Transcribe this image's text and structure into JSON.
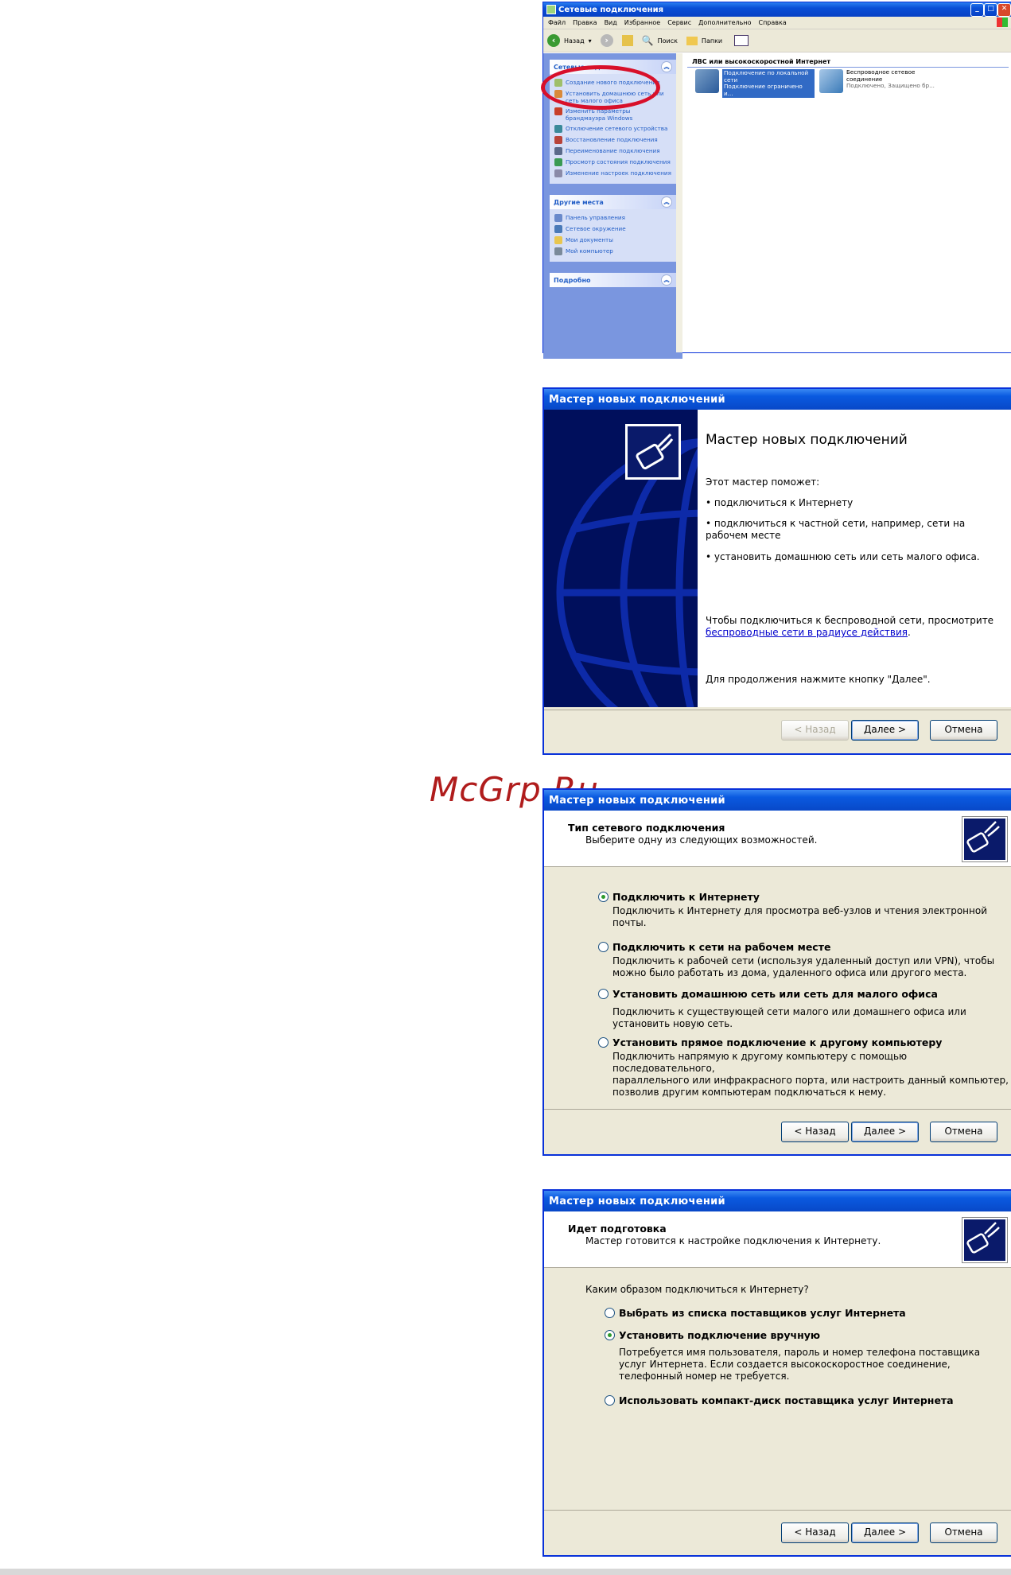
{
  "watermark": "McGrp.Ru",
  "explorer": {
    "title": "Сетевые подключения",
    "menu": [
      "Файл",
      "Правка",
      "Вид",
      "Избранное",
      "Сервис",
      "Дополнительно",
      "Справка"
    ],
    "toolbar": {
      "back": "Назад",
      "search": "Поиск",
      "folders": "Папки"
    },
    "tasks_header": "Сетевые задачи",
    "tasks": [
      "Создание нового подключения",
      "Установить домашнюю сеть или сеть малого офиса",
      "Изменить параметры брандмауэра Windows",
      "Отключение сетевого устройства",
      "Восстановление подключения",
      "Переименование подключения",
      "Просмотр состояния подключения",
      "Изменение настроек подключения"
    ],
    "places_header": "Другие места",
    "places": [
      "Панель управления",
      "Сетевое окружение",
      "Мои документы",
      "Мой компьютер"
    ],
    "details_header": "Подробно",
    "group_title": "ЛВС или высокоскоростной Интернет",
    "connections": [
      {
        "name": "Подключение по локальной сети",
        "status": "Подключение ограничено и..."
      },
      {
        "name": "Беспроводное сетевое соединение",
        "status": "Подключено, Защищено бр..."
      }
    ]
  },
  "wizard1": {
    "title": "Мастер новых подключений",
    "heading": "Мастер новых подключений",
    "intro": "Этот мастер поможет:",
    "bullets": [
      "подключиться к Интернету",
      "подключиться к частной сети, например, сети на рабочем месте",
      "установить домашнюю сеть или сеть малого офиса."
    ],
    "wireless_text": "Чтобы подключиться к беспроводной сети, просмотрите",
    "wireless_link": "беспроводные сети в радиусе действия",
    "continue_text": "Для продолжения нажмите кнопку \"Далее\".",
    "back": "< Назад",
    "next": "Далее >",
    "cancel": "Отмена"
  },
  "wizard2": {
    "title": "Мастер новых подключений",
    "header_title": "Тип сетевого подключения",
    "header_sub": "Выберите одну из следующих возможностей.",
    "options": [
      {
        "label": "Подключить к Интернету",
        "desc": [
          "Подключить к Интернету для просмотра веб-узлов и чтения электронной",
          "почты."
        ]
      },
      {
        "label": "Подключить к сети на рабочем месте",
        "desc": [
          "Подключить к рабочей сети (используя удаленный доступ или VPN), чтобы",
          "можно было работать из дома, удаленного офиса или другого места."
        ]
      },
      {
        "label": "Установить домашнюю сеть или сеть для малого офиса",
        "desc": [
          "Подключить к существующей сети малого или домашнего офиса или",
          "установить новую сеть."
        ]
      },
      {
        "label": "Установить прямое подключение к другому компьютеру",
        "desc": [
          "Подключить напрямую к другому компьютеру с помощью последовательного,",
          "параллельного или инфракрасного порта, или настроить данный компьютер,",
          "позволив другим  компьютерам подключаться к нему."
        ]
      }
    ],
    "selected": 0,
    "back": "< Назад",
    "next": "Далее >",
    "cancel": "Отмена"
  },
  "wizard3": {
    "title": "Мастер новых подключений",
    "header_title": "Идет подготовка",
    "header_sub": "Мастер готовится к настройке подключения к Интернету.",
    "question": "Каким образом подключиться к Интернету?",
    "options": [
      {
        "label": "Выбрать из списка поставщиков услуг Интернета",
        "desc": []
      },
      {
        "label": "Установить подключение вручную",
        "desc": [
          "Потребуется имя пользователя, пароль и  номер телефона поставщика",
          "услуг Интернета. Если создается высокоскоростное соединение,",
          "телефонный номер не требуется."
        ]
      },
      {
        "label": "Использовать компакт-диск поставщика услуг Интернета",
        "desc": []
      }
    ],
    "selected": 1,
    "back": "< Назад",
    "next": "Далее >",
    "cancel": "Отмена"
  },
  "colors": {
    "xp_blue": "#0a4fd6",
    "highlight_red": "#d8102a",
    "wizard_panel": "#000f5c"
  }
}
